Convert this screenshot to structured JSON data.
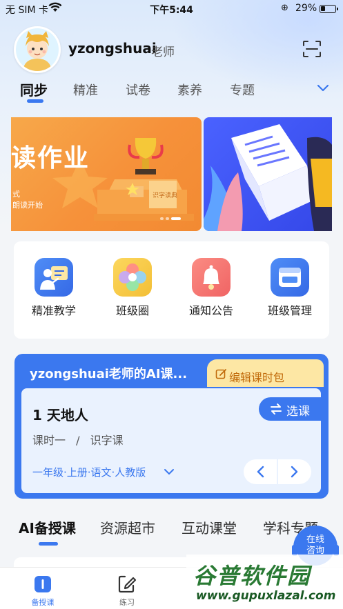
{
  "status_bar": {
    "carrier": "无 SIM 卡",
    "time": "下午5:44",
    "battery": "29%"
  },
  "header": {
    "user_name": "yzongshuai",
    "user_role": "老师"
  },
  "top_tabs": [
    {
      "label": "同步",
      "active": true
    },
    {
      "label": "精准",
      "active": false
    },
    {
      "label": "试卷",
      "active": false
    },
    {
      "label": "素养",
      "active": false
    },
    {
      "label": "专题",
      "active": false
    }
  ],
  "banner": {
    "title": "读作业",
    "sub_line_1": "式",
    "sub_line_2": "朗读开始",
    "award_label": "识字读典"
  },
  "quick_actions": [
    {
      "label": "精准教学",
      "icon": "teacher-board-icon",
      "color": "#3f7cf0"
    },
    {
      "label": "班级圈",
      "icon": "flower-icon",
      "color": "#f6c94a"
    },
    {
      "label": "通知公告",
      "icon": "bell-icon",
      "color": "#f06a6a"
    },
    {
      "label": "班级管理",
      "icon": "window-icon",
      "color": "#3f7cf0"
    }
  ],
  "ai_course": {
    "title": "yzongshuai老师的AI课...",
    "edit_label": "编辑课时包",
    "lesson_title": "1 天地人",
    "lesson_period": "课时一",
    "lesson_separator": "/",
    "lesson_type": "识字课",
    "select_label": "选课",
    "meta": "一年级·上册·语文·人教版"
  },
  "section_tabs": [
    {
      "label": "AI备授课",
      "active": true
    },
    {
      "label": "资源超市",
      "active": false
    },
    {
      "label": "互动课堂",
      "active": false
    },
    {
      "label": "学科专题",
      "active": false
    }
  ],
  "online_help": {
    "line_1": "在线",
    "line_2": "咨询"
  },
  "bottom_nav": [
    {
      "label": "备授课",
      "active": true,
      "icon": "book-icon"
    },
    {
      "label": "练习",
      "active": false,
      "icon": "edit-icon"
    }
  ],
  "watermark": {
    "brand": "谷普软件园",
    "url": "www.gupuxlazal.com"
  },
  "colors": {
    "accent": "#3b78ef",
    "banner_orange": "#f6913a",
    "edit_bg": "#fde7a4"
  }
}
